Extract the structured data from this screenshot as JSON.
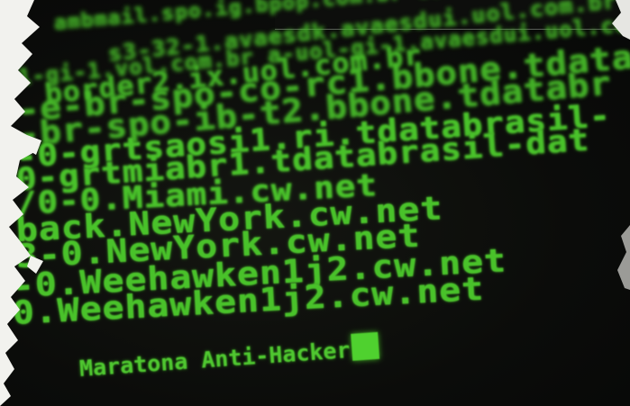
{
  "lines": [
    "ambmail.spo.ig.bpop.com.br  correio.uol",
    "s3-32-1.avaesdk.avaesdui.uol.com.br",
    "1-gi-1.vol.com.br  a-uol-gi-1.avaesdui.uol.com.br",
    "border2.ix.uol.com.br",
    "-e-br-spo-co-rc1.bbone.tdatabr",
    "-br-spo-ib-t2.bbone.tdatabr",
    "-0-grtsaosi1.ri.tdatabrasil-",
    "0-grtmiabr1.tdatabrasil-dat",
    "/0-0.Miami.cw.net",
    "back.NewYork.cw.net",
    "3-0.NewYork.cw.net",
    "-0.Weehawken1j2.cw.net",
    "0.Weehawken1j2.cw.net"
  ],
  "tagline": "Maratona Anti-Hacker",
  "colors": {
    "text_green": "#49c22a",
    "background": "#0a0b09",
    "paper": "#f2f2ee"
  }
}
